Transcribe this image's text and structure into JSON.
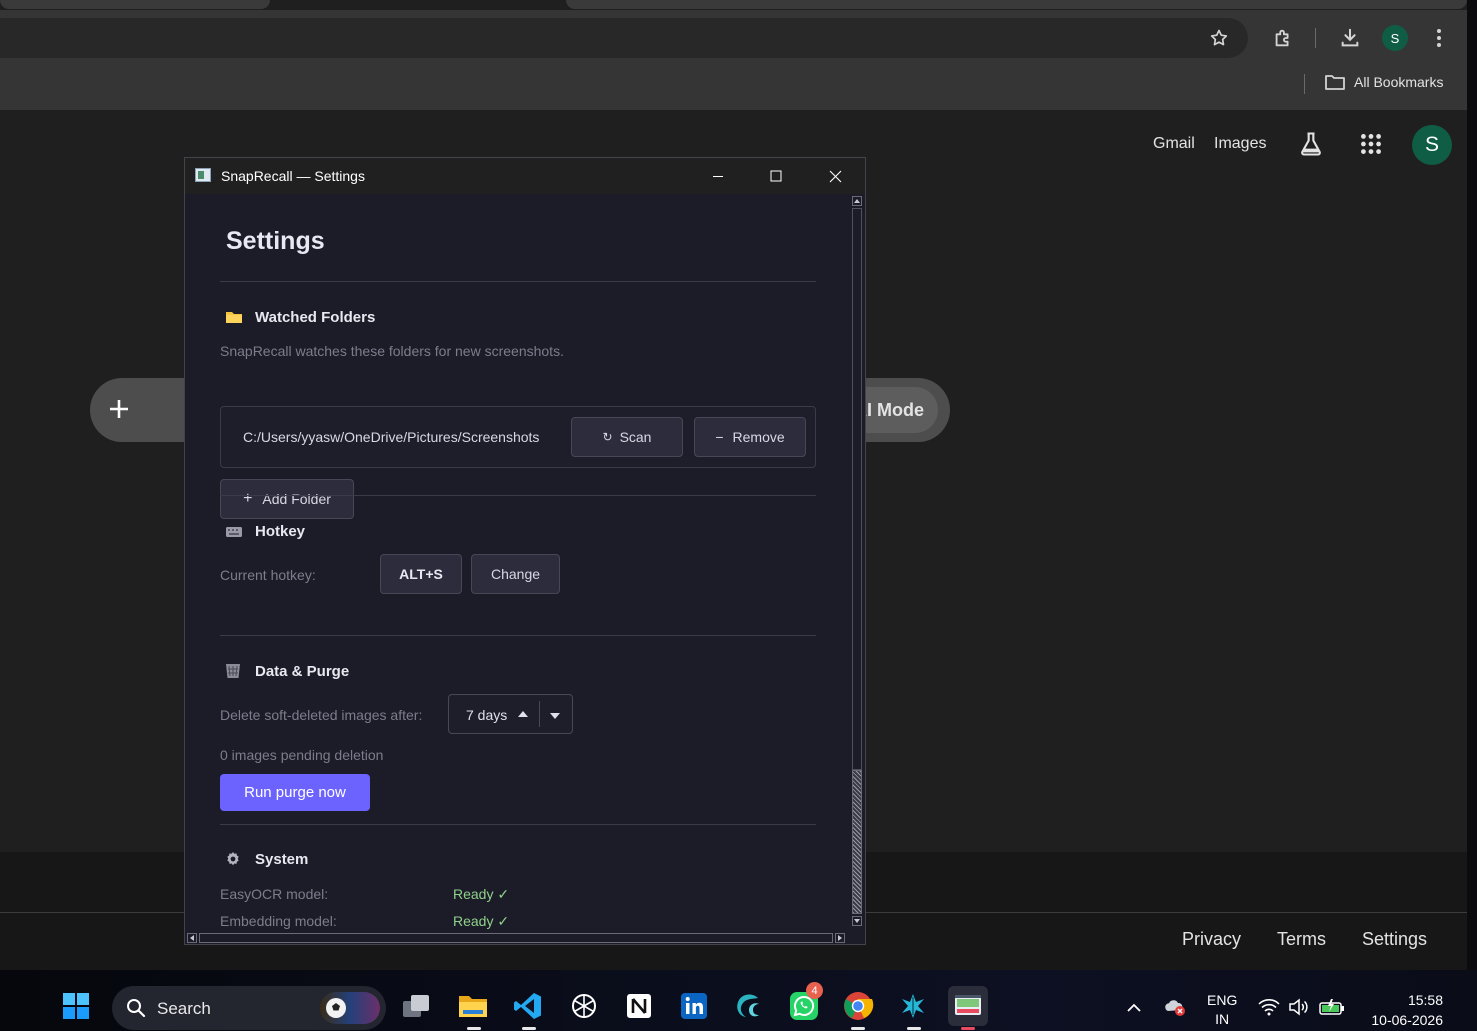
{
  "browser": {
    "bookmarks": {
      "all_bookmarks": "All Bookmarks"
    },
    "avatar_letter": "S",
    "toplinks": {
      "gmail": "Gmail",
      "images": "Images"
    },
    "ai_mode": "AI Mode",
    "footer": {
      "privacy": "Privacy",
      "terms": "Terms",
      "settings": "Settings"
    }
  },
  "window": {
    "title": "SnapRecall — Settings",
    "heading": "Settings",
    "watched": {
      "title": "Watched Folders",
      "description": "SnapRecall watches these folders for new screenshots.",
      "folders": [
        {
          "path": "C:/Users/yyasw/OneDrive/Pictures/Screenshots"
        }
      ],
      "scan_label": "Scan",
      "remove_label": "Remove",
      "add_label": "Add Folder"
    },
    "hotkey": {
      "title": "Hotkey",
      "label": "Current hotkey:",
      "value": "ALT+S",
      "change_label": "Change"
    },
    "purge": {
      "title": "Data & Purge",
      "delete_label": "Delete soft-deleted images after:",
      "days": "7 days",
      "pending": "0 images pending deletion",
      "run_label": "Run purge now",
      "accent": "#6c63ff"
    },
    "system": {
      "title": "System",
      "rows": [
        {
          "label": "EasyOCR model:",
          "status": "Ready ✓"
        },
        {
          "label": "Embedding model:",
          "status": "Ready ✓"
        }
      ],
      "ready_color": "#8fd18a"
    }
  },
  "taskbar": {
    "search_placeholder": "Search",
    "whatsapp_badge": "4",
    "language": {
      "line1": "ENG",
      "line2": "IN"
    },
    "time": "15:58",
    "date": "10-06-2026"
  }
}
